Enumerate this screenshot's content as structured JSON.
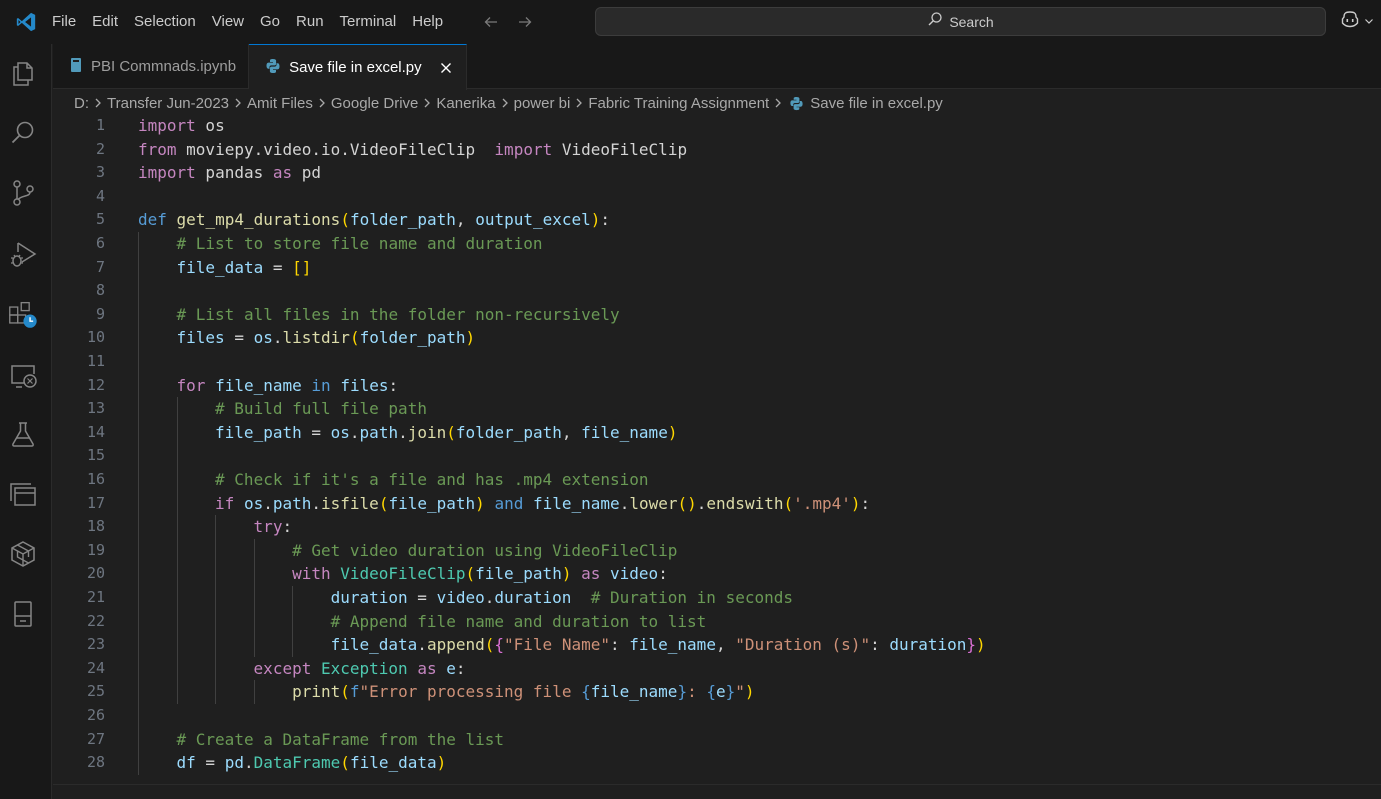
{
  "menu": [
    "File",
    "Edit",
    "Selection",
    "View",
    "Go",
    "Run",
    "Terminal",
    "Help"
  ],
  "search": {
    "label": "Search"
  },
  "activity_icons": [
    "explorer-icon",
    "search-icon",
    "source-control-icon",
    "run-debug-icon",
    "extensions-icon",
    "remote-explorer-icon",
    "testing-icon",
    "panels-icon",
    "fabric-icon",
    "notebook-icon"
  ],
  "tabs": [
    {
      "label": "PBI Commnads.ipynb",
      "icon": "notebook-file-icon",
      "active": false
    },
    {
      "label": "Save file in excel.py",
      "icon": "python-file-icon",
      "active": true
    }
  ],
  "breadcrumb": [
    "D:",
    "Transfer Jun-2023",
    "Amit Files",
    "Google Drive",
    "Kanerika",
    "power bi",
    "Fabric Training Assignment",
    "Save file in excel.py"
  ],
  "code_lines": [
    {
      "n": "1",
      "indent": 0,
      "tokens": [
        [
          "kw",
          "import"
        ],
        [
          "pl",
          " os"
        ]
      ]
    },
    {
      "n": "2",
      "indent": 0,
      "tokens": [
        [
          "kw",
          "from"
        ],
        [
          "pl",
          " moviepy.video.io.VideoFileClip  "
        ],
        [
          "kw",
          "import"
        ],
        [
          "pl",
          " VideoFileClip"
        ]
      ]
    },
    {
      "n": "3",
      "indent": 0,
      "tokens": [
        [
          "kw",
          "import"
        ],
        [
          "pl",
          " pandas "
        ],
        [
          "kw",
          "as"
        ],
        [
          "pl",
          " pd"
        ]
      ]
    },
    {
      "n": "4",
      "indent": 0,
      "tokens": []
    },
    {
      "n": "5",
      "indent": 0,
      "tokens": [
        [
          "kw2",
          "def"
        ],
        [
          "pl",
          " "
        ],
        [
          "fn",
          "get_mp4_durations"
        ],
        [
          "p1",
          "("
        ],
        [
          "var",
          "folder_path"
        ],
        [
          "pl",
          ", "
        ],
        [
          "var",
          "output_excel"
        ],
        [
          "p1",
          ")"
        ],
        [
          "pl",
          ":"
        ]
      ]
    },
    {
      "n": "6",
      "indent": 1,
      "tokens": [
        [
          "cm",
          "# List to store file name and duration"
        ]
      ]
    },
    {
      "n": "7",
      "indent": 1,
      "tokens": [
        [
          "var",
          "file_data"
        ],
        [
          "pl",
          " = "
        ],
        [
          "p1",
          "[]"
        ]
      ]
    },
    {
      "n": "8",
      "indent": 1,
      "tokens": []
    },
    {
      "n": "9",
      "indent": 1,
      "tokens": [
        [
          "cm",
          "# List all files in the folder non-recursively"
        ]
      ]
    },
    {
      "n": "10",
      "indent": 1,
      "tokens": [
        [
          "var",
          "files"
        ],
        [
          "pl",
          " = "
        ],
        [
          "var",
          "os"
        ],
        [
          "pl",
          "."
        ],
        [
          "fn",
          "listdir"
        ],
        [
          "p1",
          "("
        ],
        [
          "var",
          "folder_path"
        ],
        [
          "p1",
          ")"
        ]
      ]
    },
    {
      "n": "11",
      "indent": 1,
      "tokens": []
    },
    {
      "n": "12",
      "indent": 1,
      "tokens": [
        [
          "kw",
          "for"
        ],
        [
          "pl",
          " "
        ],
        [
          "var",
          "file_name"
        ],
        [
          "pl",
          " "
        ],
        [
          "kw2",
          "in"
        ],
        [
          "pl",
          " "
        ],
        [
          "var",
          "files"
        ],
        [
          "pl",
          ":"
        ]
      ]
    },
    {
      "n": "13",
      "indent": 2,
      "tokens": [
        [
          "cm",
          "# Build full file path"
        ]
      ]
    },
    {
      "n": "14",
      "indent": 2,
      "tokens": [
        [
          "var",
          "file_path"
        ],
        [
          "pl",
          " = "
        ],
        [
          "var",
          "os"
        ],
        [
          "pl",
          "."
        ],
        [
          "var",
          "path"
        ],
        [
          "pl",
          "."
        ],
        [
          "fn",
          "join"
        ],
        [
          "p1",
          "("
        ],
        [
          "var",
          "folder_path"
        ],
        [
          "pl",
          ", "
        ],
        [
          "var",
          "file_name"
        ],
        [
          "p1",
          ")"
        ]
      ]
    },
    {
      "n": "15",
      "indent": 2,
      "tokens": []
    },
    {
      "n": "16",
      "indent": 2,
      "tokens": [
        [
          "cm",
          "# Check if it's a file and has .mp4 extension"
        ]
      ]
    },
    {
      "n": "17",
      "indent": 2,
      "tokens": [
        [
          "kw",
          "if"
        ],
        [
          "pl",
          " "
        ],
        [
          "var",
          "os"
        ],
        [
          "pl",
          "."
        ],
        [
          "var",
          "path"
        ],
        [
          "pl",
          "."
        ],
        [
          "fn",
          "isfile"
        ],
        [
          "p1",
          "("
        ],
        [
          "var",
          "file_path"
        ],
        [
          "p1",
          ")"
        ],
        [
          "pl",
          " "
        ],
        [
          "kw2",
          "and"
        ],
        [
          "pl",
          " "
        ],
        [
          "var",
          "file_name"
        ],
        [
          "pl",
          "."
        ],
        [
          "fn",
          "lower"
        ],
        [
          "p1",
          "()"
        ],
        [
          "pl",
          "."
        ],
        [
          "fn",
          "endswith"
        ],
        [
          "p1",
          "("
        ],
        [
          "str",
          "'.mp4'"
        ],
        [
          "p1",
          ")"
        ],
        [
          "pl",
          ":"
        ]
      ]
    },
    {
      "n": "18",
      "indent": 3,
      "tokens": [
        [
          "kw",
          "try"
        ],
        [
          "pl",
          ":"
        ]
      ]
    },
    {
      "n": "19",
      "indent": 4,
      "tokens": [
        [
          "cm",
          "# Get video duration using VideoFileClip"
        ]
      ]
    },
    {
      "n": "20",
      "indent": 4,
      "tokens": [
        [
          "kw",
          "with"
        ],
        [
          "pl",
          " "
        ],
        [
          "cls",
          "VideoFileClip"
        ],
        [
          "p1",
          "("
        ],
        [
          "var",
          "file_path"
        ],
        [
          "p1",
          ")"
        ],
        [
          "pl",
          " "
        ],
        [
          "kw",
          "as"
        ],
        [
          "pl",
          " "
        ],
        [
          "var",
          "video"
        ],
        [
          "pl",
          ":"
        ]
      ]
    },
    {
      "n": "21",
      "indent": 5,
      "tokens": [
        [
          "var",
          "duration"
        ],
        [
          "pl",
          " = "
        ],
        [
          "var",
          "video"
        ],
        [
          "pl",
          "."
        ],
        [
          "var",
          "duration"
        ],
        [
          "pl",
          "  "
        ],
        [
          "cm",
          "# Duration in seconds"
        ]
      ]
    },
    {
      "n": "22",
      "indent": 5,
      "tokens": [
        [
          "cm",
          "# Append file name and duration to list"
        ]
      ]
    },
    {
      "n": "23",
      "indent": 5,
      "tokens": [
        [
          "var",
          "file_data"
        ],
        [
          "pl",
          "."
        ],
        [
          "fn",
          "append"
        ],
        [
          "p1",
          "("
        ],
        [
          "p2",
          "{"
        ],
        [
          "str",
          "\"File Name\""
        ],
        [
          "pl",
          ": "
        ],
        [
          "var",
          "file_name"
        ],
        [
          "pl",
          ", "
        ],
        [
          "str",
          "\"Duration (s)\""
        ],
        [
          "pl",
          ": "
        ],
        [
          "var",
          "duration"
        ],
        [
          "p2",
          "}"
        ],
        [
          "p1",
          ")"
        ]
      ]
    },
    {
      "n": "24",
      "indent": 3,
      "tokens": [
        [
          "kw",
          "except"
        ],
        [
          "pl",
          " "
        ],
        [
          "cls",
          "Exception"
        ],
        [
          "pl",
          " "
        ],
        [
          "kw",
          "as"
        ],
        [
          "pl",
          " "
        ],
        [
          "var",
          "e"
        ],
        [
          "pl",
          ":"
        ]
      ]
    },
    {
      "n": "25",
      "indent": 4,
      "tokens": [
        [
          "fn",
          "print"
        ],
        [
          "p1",
          "("
        ],
        [
          "kw2",
          "f"
        ],
        [
          "str",
          "\"Error processing file "
        ],
        [
          "kw2",
          "{"
        ],
        [
          "var",
          "file_name"
        ],
        [
          "kw2",
          "}"
        ],
        [
          "str",
          ": "
        ],
        [
          "kw2",
          "{"
        ],
        [
          "var",
          "e"
        ],
        [
          "kw2",
          "}"
        ],
        [
          "str",
          "\""
        ],
        [
          "p1",
          ")"
        ]
      ]
    },
    {
      "n": "26",
      "indent": 1,
      "tokens": []
    },
    {
      "n": "27",
      "indent": 1,
      "tokens": [
        [
          "cm",
          "# Create a DataFrame from the list"
        ]
      ]
    },
    {
      "n": "28",
      "indent": 1,
      "tokens": [
        [
          "var",
          "df"
        ],
        [
          "pl",
          " = "
        ],
        [
          "var",
          "pd"
        ],
        [
          "pl",
          "."
        ],
        [
          "cls",
          "DataFrame"
        ],
        [
          "p1",
          "("
        ],
        [
          "var",
          "file_data"
        ],
        [
          "p1",
          ")"
        ]
      ]
    }
  ]
}
